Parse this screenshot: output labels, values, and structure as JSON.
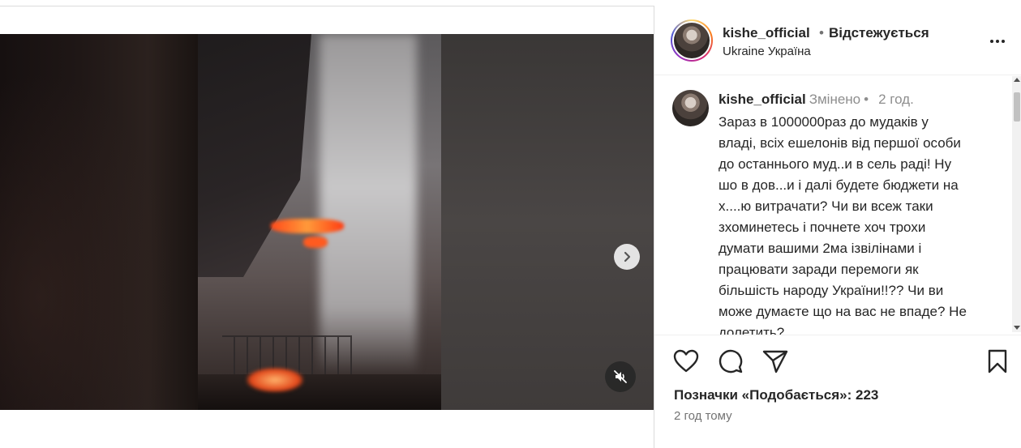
{
  "post": {
    "header": {
      "username": "kishe_official",
      "separator": "•",
      "follow_status": "Відстежується",
      "location": "Ukraine Україна"
    },
    "caption": {
      "username": "kishe_official",
      "edited": "Змінено",
      "separator": "•",
      "time": "2 год.",
      "lines": [
        "Зараз в 1000000раз до мудаків у",
        "владі, всіх ешелонів від першої особи",
        "до останнього муд..и в сель раді! Ну",
        "шо в дов...и і далі будете бюджети на",
        "х....ю витрачати? Чи ви всеж таки",
        "зхоминетесь і почнете хоч трохи",
        "думати вашими 2ма ізвілінами і",
        "працювати заради перемоги як",
        "більшість народу України!!?? Чи ви",
        "може думаєте що на вас не впаде? Не",
        "долетить?"
      ]
    },
    "likes_text": "Позначки «Подобається»: 223",
    "timestamp": "2 год тому"
  },
  "icons": {
    "like": "heart-icon",
    "comment": "comment-icon",
    "share": "share-icon",
    "save": "bookmark-icon",
    "next": "chevron-right-icon",
    "mute": "muted-speaker-icon",
    "more": "more-horizontal-icon"
  },
  "colors": {
    "text": "#262626",
    "muted": "#8e8e8e",
    "border": "#dbdbdb"
  }
}
